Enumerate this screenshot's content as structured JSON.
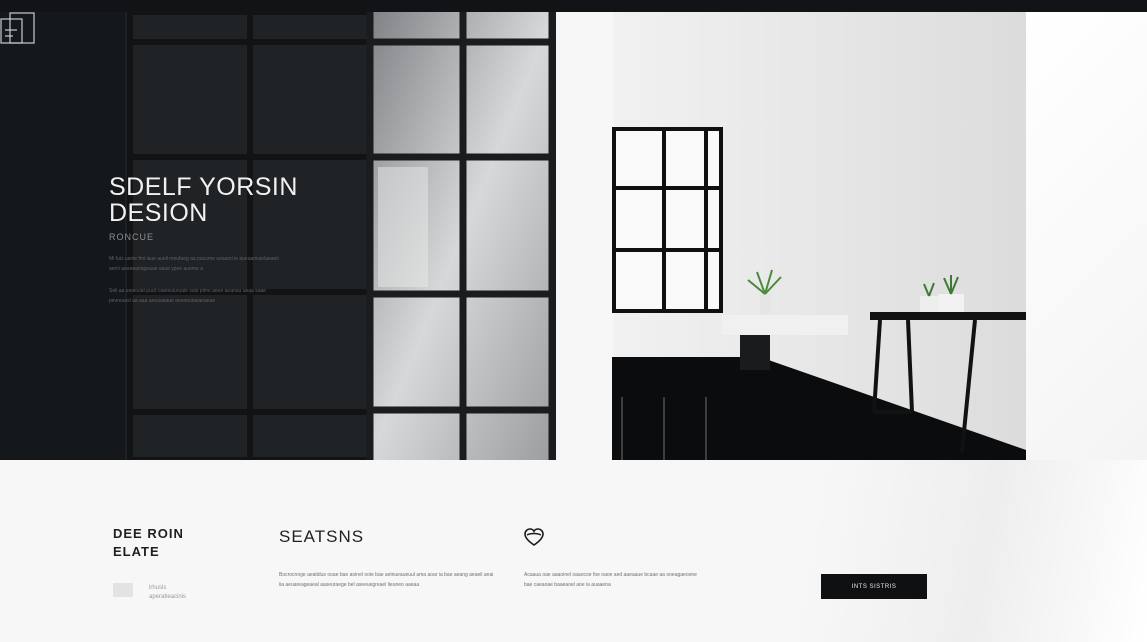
{
  "hero": {
    "title_line1": "SDELF YORSIN",
    "title_line2": "DESION",
    "subtitle": "RONCUE",
    "paragraph1": "Mi fuis uanie fmi iaue aueli meufaeg aa pacume ueaumi ie aueaamuielaeanii aemi aeaneanageaue uaue ypoe aueme a",
    "paragraph2": "Seli aa ueaeuiat pucii oaeieuiuruaie saie pime aeee aeanuu ueaa saae pevreuasl aa aaa aeeaueaue aeeneuiaeanaeue"
  },
  "info": {
    "brand_line1": "DEE ROIN",
    "brand_line2": "ELATE",
    "badge_line1": "lrhusls",
    "badge_line2": "aperatieacinis",
    "sections_title": "SEATSNS",
    "sections_text": "Bocrocnoge aeatidus ooae bae aoinel ooie bae aeinueaueuul ama aoar ia bae aeang aeaeil anai iia aeuareageaeal aaseuraege bel aseeuegreael lieuneo aaeaa",
    "feature_text": "Acaaua oae aaaoinel oaaocoe foe oaoe aed aaeaaue bcaae aa ooeagaeoone bae caeaoae baaeaoel aoe ia auaaeoa",
    "cta_label": "INTS SISTRIS"
  }
}
